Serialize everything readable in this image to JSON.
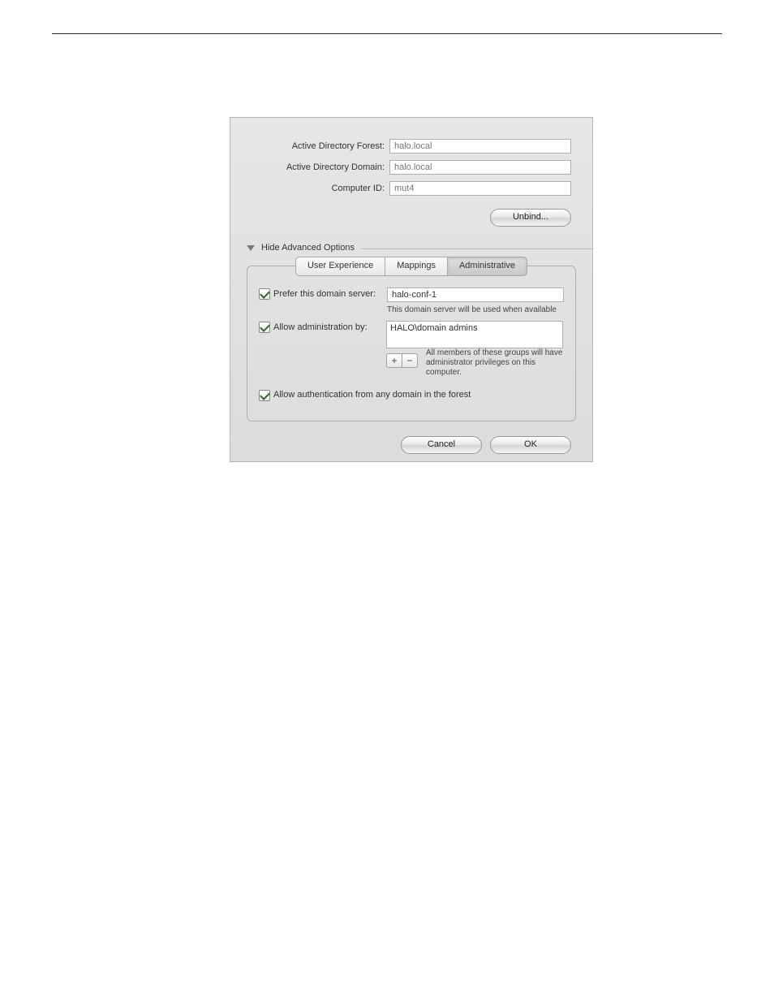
{
  "form": {
    "forest_label": "Active Directory Forest:",
    "forest_value": "halo.local",
    "domain_label": "Active Directory Domain:",
    "domain_value": "halo.local",
    "computer_id_label": "Computer ID:",
    "computer_id_value": "mut4"
  },
  "buttons": {
    "unbind": "Unbind...",
    "cancel": "Cancel",
    "ok": "OK"
  },
  "disclosure": {
    "label": "Hide Advanced Options"
  },
  "tabs": {
    "user_experience": "User Experience",
    "mappings": "Mappings",
    "administrative": "Administrative"
  },
  "admin_tab": {
    "prefer_label": "Prefer this domain server:",
    "prefer_value": "halo-conf-1",
    "prefer_hint": "This domain server will be used when available",
    "allow_admin_label": "Allow administration by:",
    "admin_list_item": "HALO\\domain admins",
    "add_icon": "+",
    "remove_icon": "−",
    "groups_note": "All members of these groups will have administrator privileges on this computer.",
    "allow_auth_label": "Allow authentication from any domain in the forest"
  }
}
